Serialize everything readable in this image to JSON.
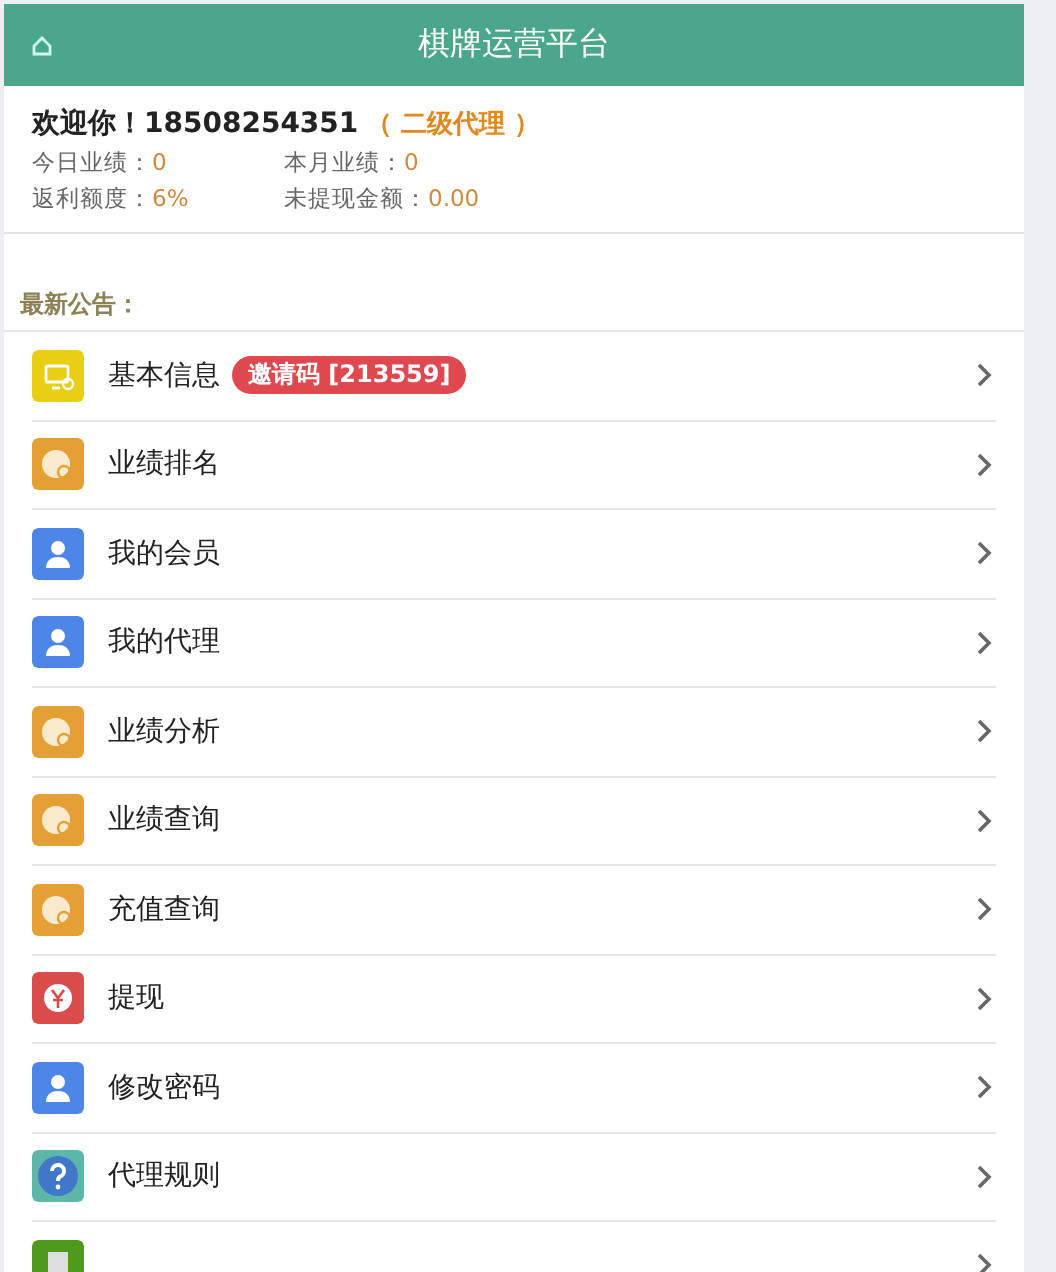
{
  "header": {
    "title": "棋牌运营平台"
  },
  "user": {
    "greeting": "欢迎你！18508254351",
    "role": "（ 二级代理 ）",
    "stats": [
      {
        "label": "今日业绩：",
        "value": "0"
      },
      {
        "label": "本月业绩：",
        "value": "0"
      },
      {
        "label": "返利额度：",
        "value": "6%"
      },
      {
        "label": "未提现金额：",
        "value": "0.00"
      }
    ]
  },
  "notice": {
    "label": "最新公告："
  },
  "menu": [
    {
      "kind": "monitor",
      "label": "基本信息",
      "badge": "邀请码 [213559]"
    },
    {
      "kind": "money-search",
      "label": "业绩排名"
    },
    {
      "kind": "user",
      "label": "我的会员"
    },
    {
      "kind": "user",
      "label": "我的代理"
    },
    {
      "kind": "money-search",
      "label": "业绩分析"
    },
    {
      "kind": "money-search",
      "label": "业绩查询"
    },
    {
      "kind": "money-search",
      "label": "充值查询"
    },
    {
      "kind": "yen",
      "label": "提现"
    },
    {
      "kind": "user",
      "label": "修改密码"
    },
    {
      "kind": "help",
      "label": "代理规则"
    },
    {
      "kind": "document"
    }
  ]
}
